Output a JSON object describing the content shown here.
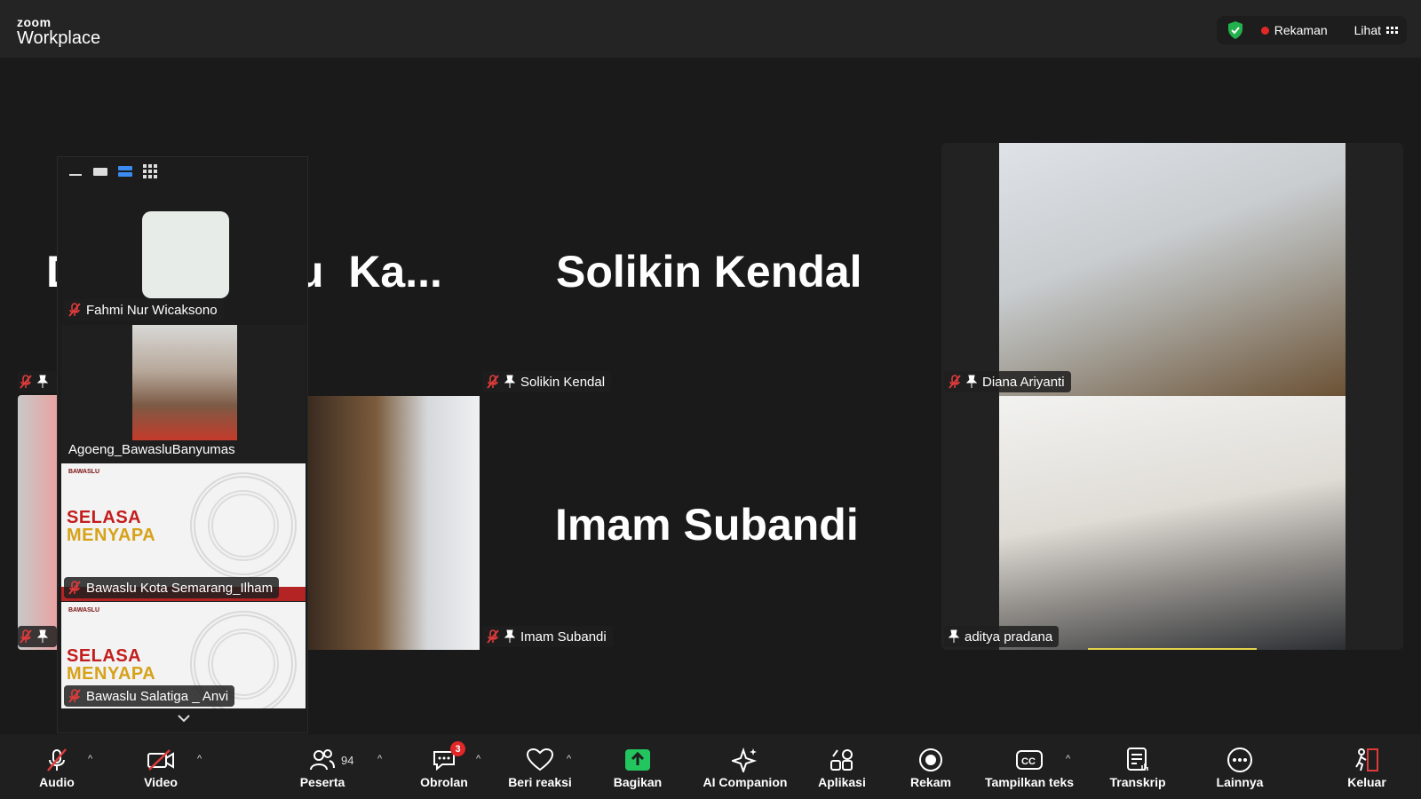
{
  "app": {
    "brand_small": "zoom",
    "brand_name": "Workplace"
  },
  "header": {
    "recording_label": "Rekaman",
    "view_label": "Lihat",
    "colors": {
      "recording": "#e02828",
      "shield": "#22b14c"
    }
  },
  "tiles": [
    {
      "id": "partial-left",
      "big_name": "D",
      "tag": ""
    },
    {
      "id": "partial-ka",
      "big_name": "u  Ka...",
      "tag": ""
    },
    {
      "id": "solikin",
      "big_name": "Solikin Kendal",
      "tag": "Solikin Kendal"
    },
    {
      "id": "imam",
      "big_name": "Imam Subandi",
      "tag": "Imam Subandi"
    },
    {
      "id": "diana",
      "big_name": "",
      "tag": "Diana Ariyanti"
    },
    {
      "id": "aditya",
      "big_name": "",
      "tag": "aditya pradana"
    }
  ],
  "panel": {
    "participants": [
      {
        "name": "Fahmi Nur Wicaksono"
      },
      {
        "name": "Agoeng_BawasluBanyumas"
      },
      {
        "name": "Bawaslu Kota Semarang_Ilham",
        "banner": {
          "logo": "BAWASLU",
          "line1": "SELASA",
          "line2": "MENYAPA"
        }
      },
      {
        "name": "Bawaslu Salatiga _ Anvi",
        "banner": {
          "logo": "BAWASLU",
          "line1": "SELASA",
          "line2": "MENYAPA"
        }
      }
    ]
  },
  "toolbar": {
    "audio": "Audio",
    "video": "Video",
    "participants": "Peserta",
    "participants_count": "94",
    "chat": "Obrolan",
    "chat_badge": "3",
    "react": "Beri reaksi",
    "share": "Bagikan",
    "ai": "AI Companion",
    "apps": "Aplikasi",
    "record": "Rekam",
    "captions": "Tampilkan teks",
    "transcript": "Transkrip",
    "more": "Lainnya",
    "leave": "Keluar",
    "colors": {
      "share": "#22c55e",
      "mute": "#e03b3b",
      "leave": "#e03b3b"
    }
  }
}
